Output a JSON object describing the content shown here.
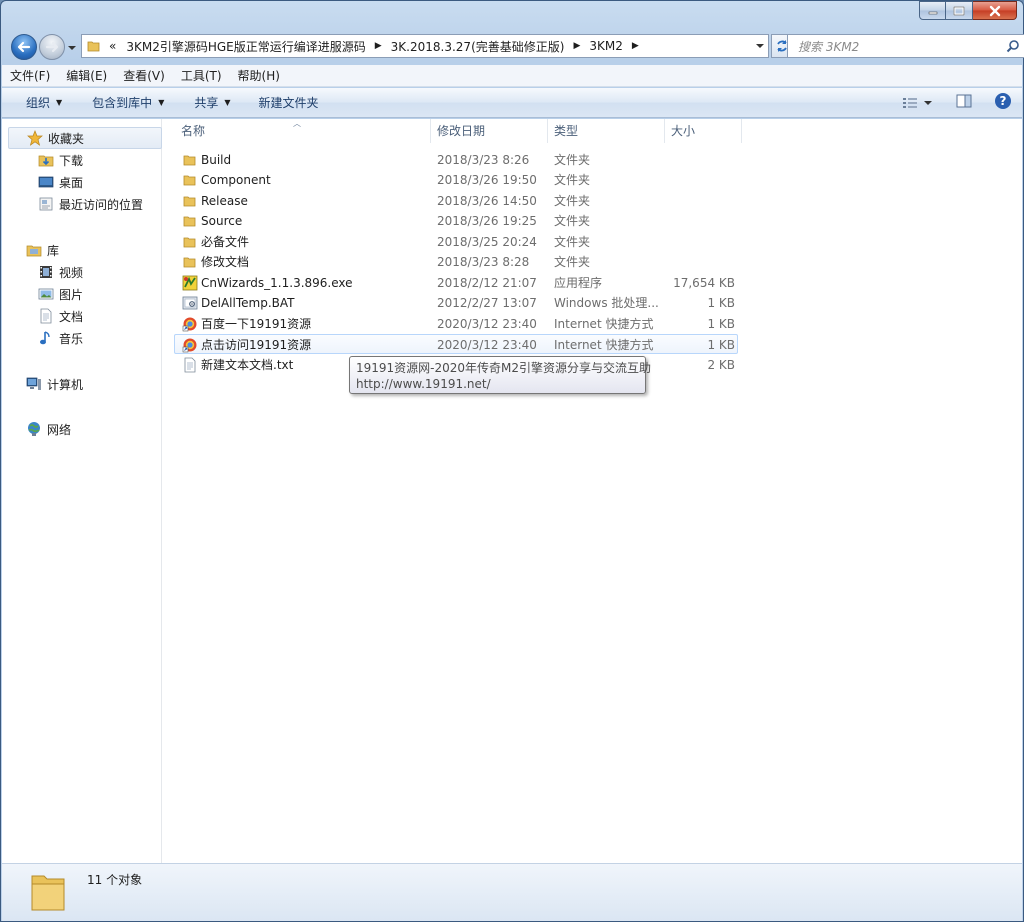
{
  "window": {
    "controls": {
      "minimize_icon": "minimize-icon",
      "maximize_icon": "maximize-icon",
      "close_icon": "close-icon"
    }
  },
  "address": {
    "prefix": "«",
    "segments": [
      "3KM2引擎源码HGE版正常运行编译进服源码",
      "3K.2018.3.27(完善基础修正版)",
      "3KM2"
    ]
  },
  "search": {
    "placeholder": "搜索 3KM2"
  },
  "menu": [
    "文件(F)",
    "编辑(E)",
    "查看(V)",
    "工具(T)",
    "帮助(H)"
  ],
  "commands": [
    {
      "label": "组织",
      "has_dropdown": true
    },
    {
      "label": "包含到库中",
      "has_dropdown": true
    },
    {
      "label": "共享",
      "has_dropdown": true
    },
    {
      "label": "新建文件夹",
      "has_dropdown": false
    }
  ],
  "nav": {
    "favorites": {
      "label": "收藏夹",
      "items": [
        "下载",
        "桌面",
        "最近访问的位置"
      ]
    },
    "libraries": {
      "label": "库",
      "items": [
        "视频",
        "图片",
        "文档",
        "音乐"
      ]
    },
    "computer": {
      "label": "计算机"
    },
    "network": {
      "label": "网络"
    }
  },
  "columns": {
    "name": "名称",
    "date": "修改日期",
    "type": "类型",
    "size": "大小"
  },
  "files": [
    {
      "name": "Build",
      "date": "2018/3/23 8:26",
      "type": "文件夹",
      "size": "",
      "icon": "folder"
    },
    {
      "name": "Component",
      "date": "2018/3/26 19:50",
      "type": "文件夹",
      "size": "",
      "icon": "folder"
    },
    {
      "name": "Release",
      "date": "2018/3/26 14:50",
      "type": "文件夹",
      "size": "",
      "icon": "folder"
    },
    {
      "name": "Source",
      "date": "2018/3/26 19:25",
      "type": "文件夹",
      "size": "",
      "icon": "folder"
    },
    {
      "name": "必备文件",
      "date": "2018/3/25 20:24",
      "type": "文件夹",
      "size": "",
      "icon": "folder"
    },
    {
      "name": "修改文档",
      "date": "2018/3/23 8:28",
      "type": "文件夹",
      "size": "",
      "icon": "folder"
    },
    {
      "name": "CnWizards_1.1.3.896.exe",
      "date": "2018/2/12 21:07",
      "type": "应用程序",
      "size": "17,654 KB",
      "icon": "exe"
    },
    {
      "name": "DelAllTemp.BAT",
      "date": "2012/2/27 13:07",
      "type": "Windows 批处理...",
      "size": "1 KB",
      "icon": "bat"
    },
    {
      "name": "百度一下19191资源",
      "date": "2020/3/12 23:40",
      "type": "Internet 快捷方式",
      "size": "1 KB",
      "icon": "url"
    },
    {
      "name": "点击访问19191资源",
      "date": "2020/3/12 23:40",
      "type": "Internet 快捷方式",
      "size": "1 KB",
      "icon": "url"
    },
    {
      "name": "新建文本文档.txt",
      "date": "",
      "type": "",
      "size": "2 KB",
      "icon": "txt"
    }
  ],
  "tooltip": {
    "line1": "19191资源网-2020年传奇M2引擎资源分享与交流互助",
    "line2": "http://www.19191.net/"
  },
  "status": {
    "count_text": "11 个对象"
  }
}
